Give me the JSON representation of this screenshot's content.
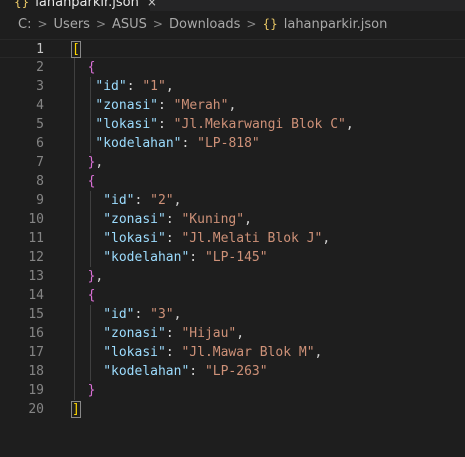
{
  "tab": {
    "label": "lahanparkir.json",
    "close_glyph": "×",
    "icon": "json-file-icon"
  },
  "breadcrumb": {
    "parts": [
      "C:",
      "Users",
      "ASUS",
      "Downloads"
    ],
    "file": "lahanparkir.json",
    "separator": ">",
    "file_icon": "json-file-icon"
  },
  "editor": {
    "current_line": 1,
    "lines": [
      {
        "n": "1",
        "text": "["
      },
      {
        "n": "2",
        "text": "{"
      },
      {
        "n": "3",
        "key": "\"id\"",
        "value": "\"1\""
      },
      {
        "n": "4",
        "key": "\"zonasi\"",
        "value": "\"Merah\""
      },
      {
        "n": "5",
        "key": "\"lokasi\"",
        "value": "\"Jl.Mekarwangi Blok C\""
      },
      {
        "n": "6",
        "key": "\"kodelahan\"",
        "value": "\"LP-818\""
      },
      {
        "n": "7",
        "text": "},"
      },
      {
        "n": "8",
        "text": "{"
      },
      {
        "n": "9",
        "key": "\"id\"",
        "value": "\"2\""
      },
      {
        "n": "10",
        "key": "\"zonasi\"",
        "value": "\"Kuning\""
      },
      {
        "n": "11",
        "key": "\"lokasi\"",
        "value": "\"Jl.Melati Blok J\""
      },
      {
        "n": "12",
        "key": "\"kodelahan\"",
        "value": "\"LP-145\""
      },
      {
        "n": "13",
        "text": "},"
      },
      {
        "n": "14",
        "text": "{"
      },
      {
        "n": "15",
        "key": "\"id\"",
        "value": "\"3\""
      },
      {
        "n": "16",
        "key": "\"zonasi\"",
        "value": "\"Hijau\""
      },
      {
        "n": "17",
        "key": "\"lokasi\"",
        "value": "\"Jl.Mawar Blok M\""
      },
      {
        "n": "18",
        "key": "\"kodelahan\"",
        "value": "\"LP-263\""
      },
      {
        "n": "19",
        "text": "}"
      },
      {
        "n": "20",
        "text": "]"
      }
    ]
  },
  "colors": {
    "background": "#1e1e1e",
    "key": "#9cdcfe",
    "string": "#ce9178",
    "bracket_outer": "#ffd700",
    "bracket_inner": "#da70d6",
    "line_number": "#858585"
  }
}
